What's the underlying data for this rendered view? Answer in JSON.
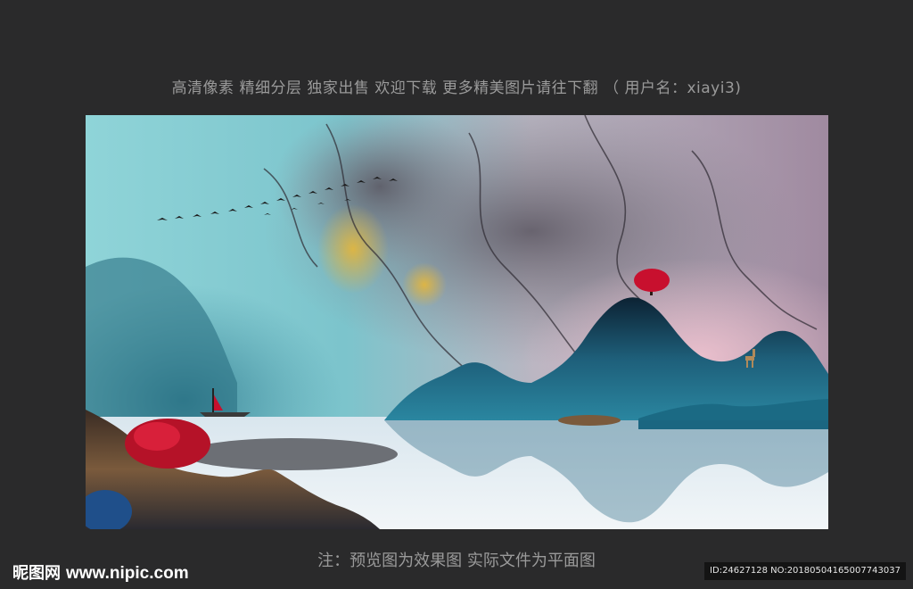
{
  "caption_top": "高清像素 精细分层 独家出售 欢迎下载 更多精美图片请往下翻 （ 用户名：xiayi3)",
  "caption_bottom": "注：预览图为效果图 实际文件为平面图",
  "watermark": {
    "brand": "昵图网",
    "url": "www.nipic.com"
  },
  "image_id": "ID:24627128 NO:20180504165007743037",
  "artwork": {
    "colors": {
      "sky_cyan": "#8fd4d8",
      "mist_grey": "#b8b2bd",
      "pink_haze": "#e3b6c2",
      "mountain_teal": "#1f5e78",
      "mountain_dark": "#0e2a3c",
      "red_tree": "#c8102e",
      "water": "#dfeaf0",
      "brown_hill": "#5a4030"
    }
  }
}
